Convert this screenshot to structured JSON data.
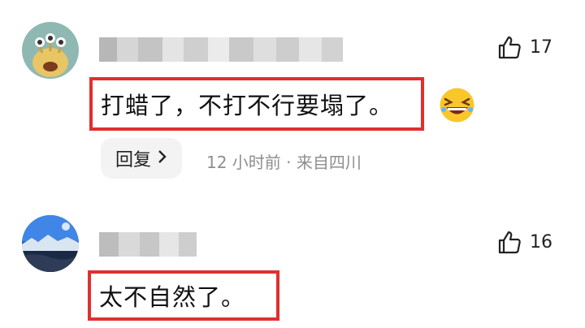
{
  "comments": [
    {
      "likes": "17",
      "text": "打蜡了，不打不行要塌了。",
      "emoji": "laughing-face",
      "reply_label": "回复",
      "meta": "12 小时前 · 来自四川"
    },
    {
      "likes": "16",
      "text": "太不自然了。"
    }
  ],
  "colors": {
    "highlight": "#e0302f",
    "meta": "#8e8e8e",
    "reply_bg": "#f3f3f3"
  }
}
